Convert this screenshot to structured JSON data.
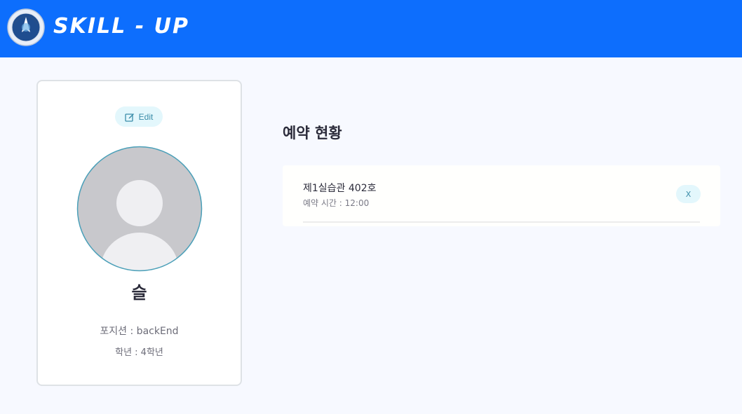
{
  "header": {
    "brand": "SKILL - UP",
    "bg_color": "#0d6efd",
    "logo_icon": "university-seal-icon"
  },
  "profile": {
    "edit_label": "Edit",
    "edit_icon": "edit-icon",
    "avatar_icon": "user-placeholder-icon",
    "name": "슬",
    "position": "포지션 : backEnd",
    "grade": "학년 : 4학년"
  },
  "reservations": {
    "title": "예약 현황",
    "items": [
      {
        "room": "제1실습관 402호",
        "time": "예약 시간 : 12:00",
        "cancel_label": "X"
      }
    ]
  },
  "colors": {
    "accent": "#0d6efd",
    "button_bg": "#e3f7fc",
    "button_text": "#3a8ca8",
    "avatar_border": "#4a9fb8"
  }
}
